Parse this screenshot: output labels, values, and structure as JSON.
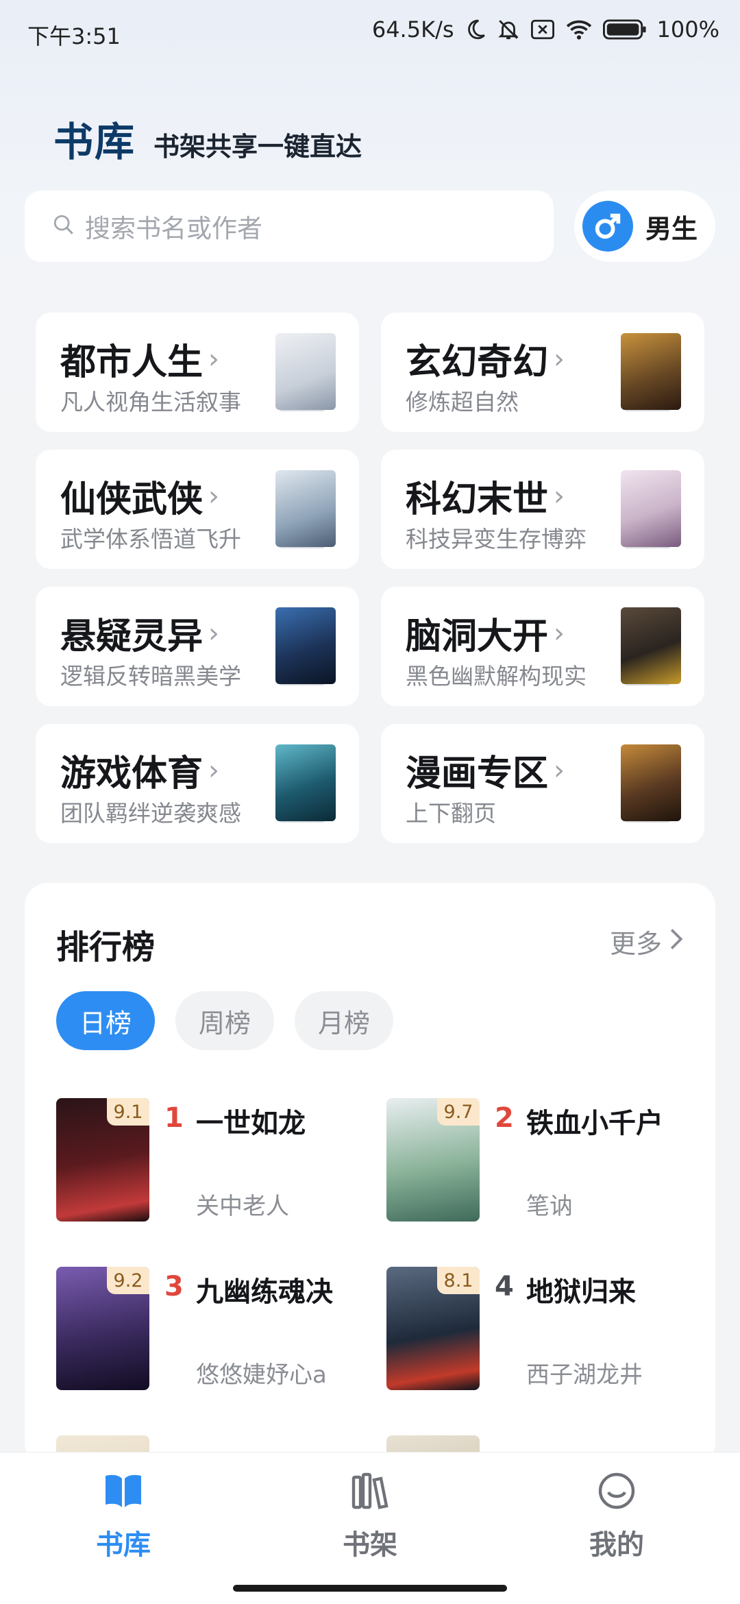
{
  "status_bar": {
    "time": "下午3:51",
    "network_speed": "64.5K/s",
    "battery": "100%",
    "icons": [
      "moon-icon",
      "bell-off-icon",
      "sim-off-icon",
      "wifi-icon",
      "battery-icon"
    ]
  },
  "header": {
    "title": "书库",
    "subtitle": "书架共享一键直达"
  },
  "search": {
    "placeholder": "搜索书名或作者",
    "icon": "search-icon"
  },
  "gender": {
    "label": "男生",
    "icon": "male-icon",
    "color": "#2b8cf0"
  },
  "categories": [
    {
      "title": "都市人生",
      "desc": "凡人视角生活叙事",
      "cover_color": "#d8dde6"
    },
    {
      "title": "玄幻奇幻",
      "desc": "修炼超自然",
      "cover_color": "#6a4a25"
    },
    {
      "title": "仙侠武侠",
      "desc": "武学体系悟道飞升",
      "cover_color": "#8fa3b8"
    },
    {
      "title": "科幻末世",
      "desc": "科技异变生存博弈",
      "cover_color": "#c9b3c8"
    },
    {
      "title": "悬疑灵异",
      "desc": "逻辑反转暗黑美学",
      "cover_color": "#1c3358"
    },
    {
      "title": "脑洞大开",
      "desc": "黑色幽默解构现实",
      "cover_color": "#2a2420"
    },
    {
      "title": "游戏体育",
      "desc": "团队羁绊逆袭爽感",
      "cover_color": "#1d5a6e"
    },
    {
      "title": "漫画专区",
      "desc": "上下翻页",
      "cover_color": "#5a3a22"
    }
  ],
  "ranking": {
    "title": "排行榜",
    "more": "更多",
    "tabs": [
      {
        "label": "日榜",
        "active": true
      },
      {
        "label": "周榜",
        "active": false
      },
      {
        "label": "月榜",
        "active": false
      }
    ],
    "books": [
      {
        "rank": "1",
        "title": "一世如龙",
        "author": "关中老人",
        "score": "9.1",
        "rank_color": "#e0473c",
        "cover_color": "#5a1a1e"
      },
      {
        "rank": "2",
        "title": "铁血小千户",
        "author": "笔讷",
        "score": "9.7",
        "rank_color": "#e0473c",
        "cover_color": "#8bb39a"
      },
      {
        "rank": "3",
        "title": "九幽练魂决",
        "author": "悠悠婕妤心a",
        "score": "9.2",
        "rank_color": "#e0473c",
        "cover_color": "#3a2a5e"
      },
      {
        "rank": "4",
        "title": "地狱归来",
        "author": "西子湖龙井",
        "score": "8.1",
        "rank_color": "#4a4d54",
        "cover_color": "#1e2a3a"
      }
    ]
  },
  "bottom_nav": [
    {
      "label": "书库",
      "icon": "book-open-icon",
      "active": true
    },
    {
      "label": "书架",
      "icon": "bookshelf-icon",
      "active": false
    },
    {
      "label": "我的",
      "icon": "smile-icon",
      "active": false
    }
  ],
  "accent_color": "#2e8df2"
}
